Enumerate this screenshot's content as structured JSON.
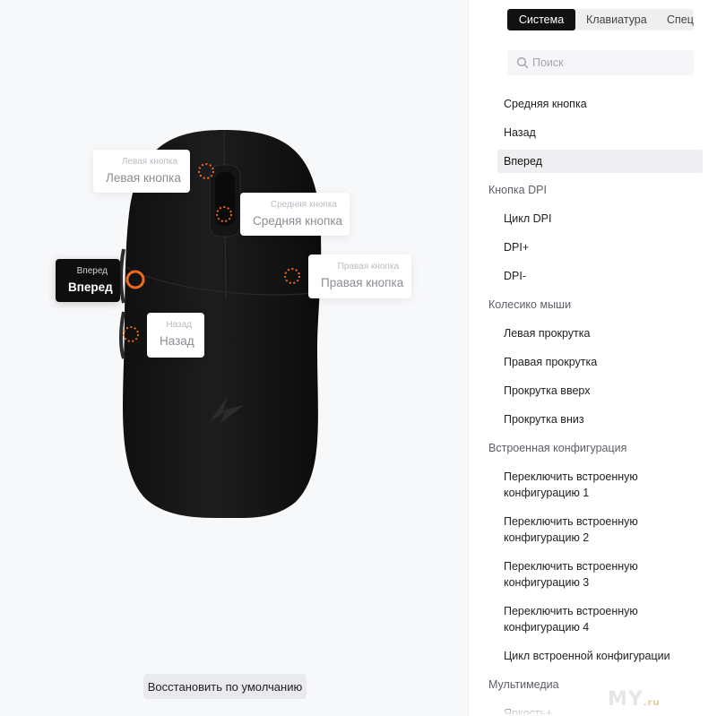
{
  "colors": {
    "accent": "#f26b1d",
    "dark": "#0e0e0e",
    "panel_bg": "#ffffff",
    "stage_bg": "#f7f8fa"
  },
  "callouts": {
    "left": {
      "small": "Левая кнопка",
      "big": "Левая кнопка"
    },
    "middle": {
      "small": "Средняя кнопка",
      "big": "Средняя кнопка"
    },
    "right": {
      "small": "Правая кнопка",
      "big": "Правая кнопка"
    },
    "forward": {
      "small": "Вперед",
      "big": "Вперед"
    },
    "back": {
      "small": "Назад",
      "big": "Назад"
    }
  },
  "reset_label": "Восстановить по умолчанию",
  "tabs": [
    "Система",
    "Клавиатура",
    "Специаль"
  ],
  "search": {
    "placeholder": "Поиск",
    "icon": "search-icon"
  },
  "list": [
    {
      "type": "item",
      "label": "Средняя кнопка"
    },
    {
      "type": "item",
      "label": "Назад"
    },
    {
      "type": "item",
      "label": "Вперед",
      "selected": true
    },
    {
      "type": "group",
      "label": "Кнопка DPI"
    },
    {
      "type": "item",
      "label": "Цикл DPI"
    },
    {
      "type": "item",
      "label": "DPI+"
    },
    {
      "type": "item",
      "label": "DPI-"
    },
    {
      "type": "group",
      "label": "Колесико мыши"
    },
    {
      "type": "item",
      "label": "Левая прокрутка"
    },
    {
      "type": "item",
      "label": "Правая прокрутка"
    },
    {
      "type": "item",
      "label": "Прокрутка вверх"
    },
    {
      "type": "item",
      "label": "Прокрутка вниз"
    },
    {
      "type": "group",
      "label": "Встроенная конфигурация"
    },
    {
      "type": "item",
      "label": "Переключить встроенную конфигурацию 1"
    },
    {
      "type": "item",
      "label": "Переключить встроенную конфигурацию 2"
    },
    {
      "type": "item",
      "label": "Переключить встроенную конфигурацию 3"
    },
    {
      "type": "item",
      "label": "Переключить встроенную конфигурацию 4"
    },
    {
      "type": "item",
      "label": "Цикл встроенной конфигурации"
    },
    {
      "type": "group",
      "label": "Мультимедиа"
    },
    {
      "type": "item",
      "label": "Яркость+"
    }
  ],
  "watermark": {
    "text": "MY",
    "suffix": ".ru"
  }
}
